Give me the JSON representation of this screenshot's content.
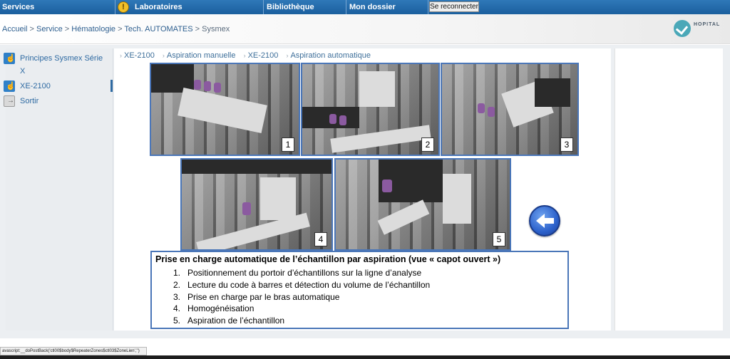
{
  "topnav": {
    "services": "Services",
    "alert_icon": "alert-icon",
    "labs": "Laboratoires",
    "biblio": "Bibliothèque",
    "dossier": "Mon dossier",
    "reconnect": "Se reconnecter"
  },
  "breadcrumb": {
    "items": [
      "Accueil",
      "Service",
      "Hématologie",
      "Tech. AUTOMATES",
      "Sysmex"
    ],
    "separator": ">"
  },
  "logo": {
    "name": "HOPITAL"
  },
  "sidebar": {
    "items": [
      {
        "label": "Principes Sysmex Série X",
        "icon": "hand-pointer-icon"
      },
      {
        "label": "XE-2100",
        "icon": "hand-pointer-icon"
      },
      {
        "label": "Sortir",
        "icon": "exit-icon"
      }
    ]
  },
  "subnav": {
    "tabs": [
      "XE-2100",
      "Aspiration manuelle",
      "XE-2100",
      "Aspiration automatique"
    ]
  },
  "photos": {
    "labels": [
      "1",
      "2",
      "3",
      "4",
      "5"
    ]
  },
  "back_button": {
    "icon": "back-arrow-icon"
  },
  "caption": {
    "title": "Prise en charge automatique de l’échantillon par aspiration (vue « capot ouvert »)",
    "steps": [
      {
        "n": "1.",
        "text": "Positionnement du portoir d’échantillons sur la ligne d’analyse"
      },
      {
        "n": "2.",
        "text": "Lecture du code à barres et détection du volume de l’échantillon"
      },
      {
        "n": "3.",
        "text": "Prise en charge par le bras automatique"
      },
      {
        "n": "4.",
        "text": "Homogénéisation"
      },
      {
        "n": "5.",
        "text": "Aspiration de l’échantillon"
      }
    ]
  },
  "statusbar": {
    "text": "avascript:__doPostBack('ctl00$body$RepeaterZones$ctl03$ZoneLien','')"
  },
  "colors": {
    "nav_blue": "#1b5f9e",
    "link_blue": "#2e6aa2",
    "frame_blue": "#4a76b8"
  }
}
